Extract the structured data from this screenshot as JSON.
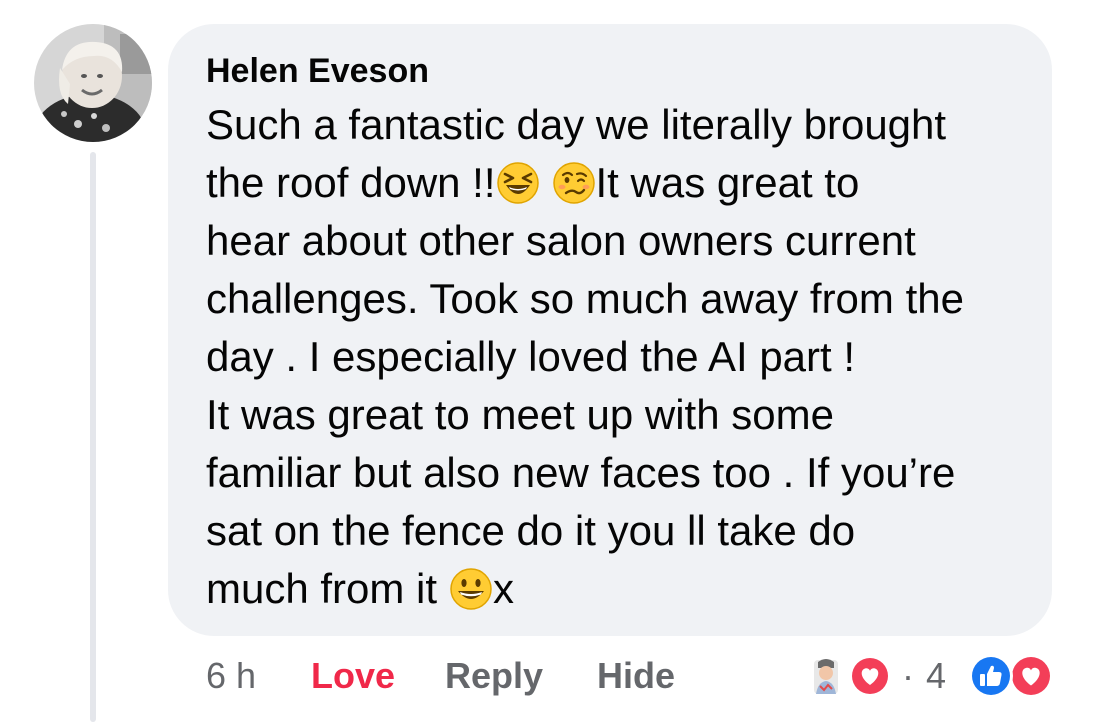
{
  "comment": {
    "author": "Helen Eveson",
    "lines": [
      {
        "parts": [
          "Such a fantastic day we literally brought"
        ]
      },
      {
        "parts": [
          "the roof down !!",
          "It was great to"
        ],
        "emojis": [
          "laughing-squint-emoji",
          "woozy-face-emoji"
        ]
      },
      {
        "parts": [
          "hear about other salon owners current"
        ]
      },
      {
        "parts": [
          "challenges. Took so much away from the"
        ]
      },
      {
        "parts": [
          "day . I especially loved the AI part !"
        ]
      },
      {
        "parts": [
          "It was great to meet up with some"
        ]
      },
      {
        "parts": [
          "familiar but also new faces too . If you’re"
        ]
      },
      {
        "parts": [
          "sat on the fence do it you ll take do"
        ]
      },
      {
        "parts": [
          "much from it",
          "x"
        ],
        "emojis": [
          "grinning-face-emoji"
        ]
      }
    ]
  },
  "actions": {
    "time": "6 h",
    "love": "Love",
    "reply": "Reply",
    "hide": "Hide"
  },
  "reactions": {
    "separator": "·",
    "count": "4",
    "types": [
      "like",
      "love"
    ]
  },
  "colors": {
    "bubble": "#f0f2f5",
    "love": "#f02849",
    "like": "#1877f2",
    "muted": "#65676b",
    "text": "#050505"
  }
}
